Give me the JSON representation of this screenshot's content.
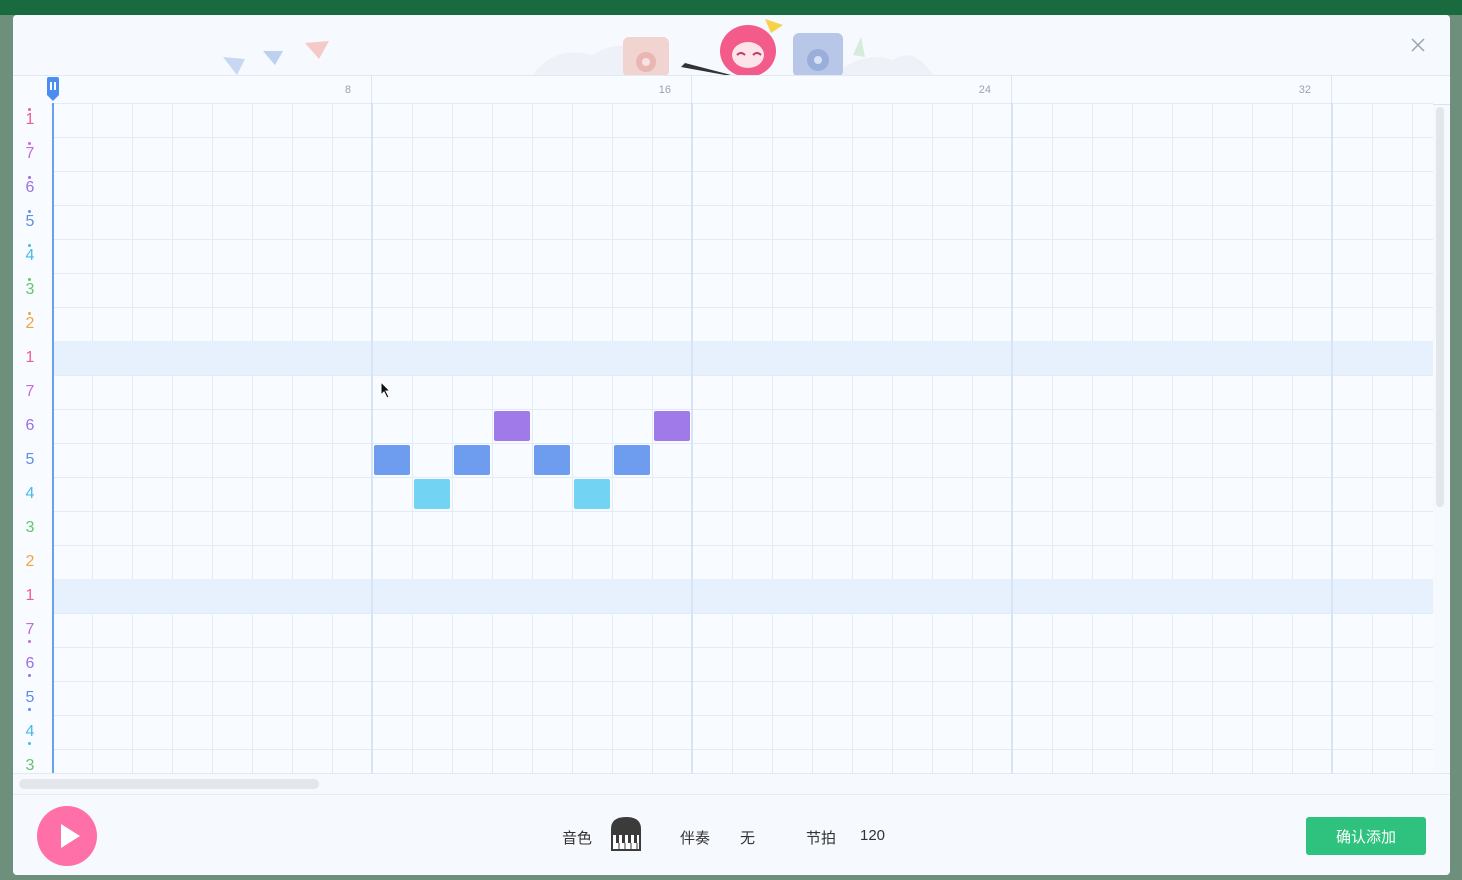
{
  "theme": {
    "accent_pink": "#ff6fa8",
    "confirm_green": "#2ec27e",
    "note_blue": "#6e9df0",
    "note_purple": "#a07ae8",
    "note_cyan": "#72d3f2",
    "playhead": "#4c8ef0"
  },
  "ruler": {
    "labels": [
      "8",
      "16",
      "24",
      "32"
    ]
  },
  "notes": {
    "rows": [
      {
        "digit": "1",
        "octave": "high",
        "color": "#ef5d8e"
      },
      {
        "digit": "7",
        "octave": "high",
        "color": "#c56bd8"
      },
      {
        "digit": "6",
        "octave": "high",
        "color": "#9b6ee8"
      },
      {
        "digit": "5",
        "octave": "high",
        "color": "#5d8fe6"
      },
      {
        "digit": "4",
        "octave": "high",
        "color": "#4bb8e8"
      },
      {
        "digit": "3",
        "octave": "high",
        "color": "#5fc76a"
      },
      {
        "digit": "2",
        "octave": "high",
        "color": "#f2a640"
      },
      {
        "digit": "1",
        "octave": "mid",
        "color": "#ef5d8e"
      },
      {
        "digit": "7",
        "octave": "mid",
        "color": "#c56bd8"
      },
      {
        "digit": "6",
        "octave": "mid",
        "color": "#9b6ee8"
      },
      {
        "digit": "5",
        "octave": "mid",
        "color": "#5d8fe6"
      },
      {
        "digit": "4",
        "octave": "mid",
        "color": "#4bb8e8"
      },
      {
        "digit": "3",
        "octave": "mid",
        "color": "#5fc76a"
      },
      {
        "digit": "2",
        "octave": "mid",
        "color": "#f2a640"
      },
      {
        "digit": "1",
        "octave": "mid",
        "color": "#ef5d8e"
      },
      {
        "digit": "7",
        "octave": "low",
        "color": "#c56bd8"
      },
      {
        "digit": "6",
        "octave": "low",
        "color": "#9b6ee8"
      },
      {
        "digit": "5",
        "octave": "low",
        "color": "#5d8fe6"
      },
      {
        "digit": "4",
        "octave": "low",
        "color": "#4bb8e8"
      },
      {
        "digit": "3",
        "octave": "low",
        "color": "#5fc76a"
      }
    ],
    "placed": [
      {
        "step": 9,
        "pitch": "5",
        "color": "#6e9df0"
      },
      {
        "step": 10,
        "pitch": "4",
        "color": "#72d3f2"
      },
      {
        "step": 11,
        "pitch": "5",
        "color": "#6e9df0"
      },
      {
        "step": 12,
        "pitch": "6",
        "color": "#a07ae8"
      },
      {
        "step": 13,
        "pitch": "5",
        "color": "#6e9df0"
      },
      {
        "step": 14,
        "pitch": "4",
        "color": "#72d3f2"
      },
      {
        "step": 15,
        "pitch": "5",
        "color": "#6e9df0"
      },
      {
        "step": 16,
        "pitch": "6",
        "color": "#a07ae8"
      }
    ]
  },
  "footer": {
    "timbre_label": "音色",
    "accompaniment_label": "伴奏",
    "accompaniment_value": "无",
    "tempo_label": "节拍",
    "tempo_value": "120",
    "confirm_label": "确认添加"
  }
}
